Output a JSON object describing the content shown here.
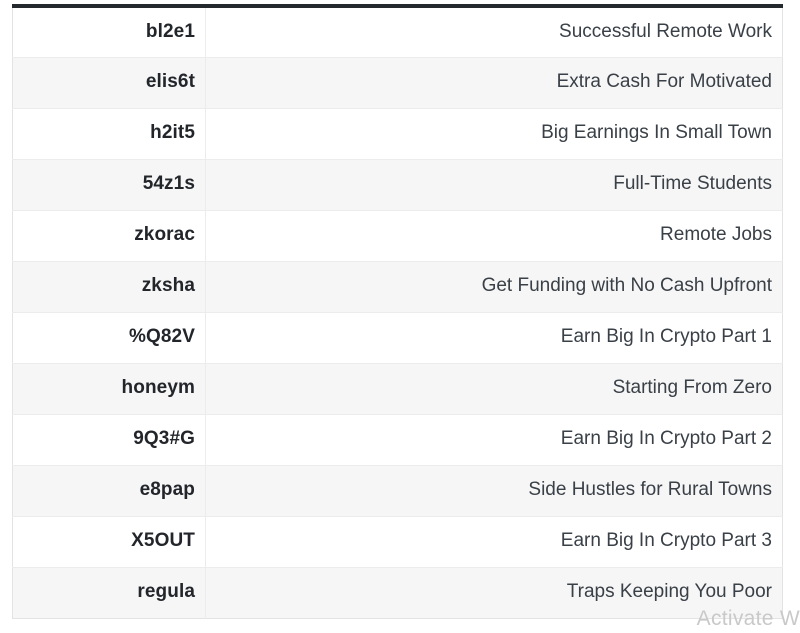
{
  "table": {
    "columns": [
      {
        "key": "code",
        "header": ""
      },
      {
        "key": "title",
        "header": ""
      }
    ],
    "rows": [
      {
        "code": "bl2e1",
        "title": "Successful Remote Work"
      },
      {
        "code": "elis6t",
        "title": "Extra Cash For Motivated"
      },
      {
        "code": "h2it5",
        "title": "Big Earnings In Small Town"
      },
      {
        "code": "54z1s",
        "title": "Full-Time Students"
      },
      {
        "code": "zkorac",
        "title": "Remote Jobs"
      },
      {
        "code": "zksha",
        "title": "Get Funding with No Cash Upfront"
      },
      {
        "code": "%Q82V",
        "title": "Earn Big In Crypto Part 1"
      },
      {
        "code": "honeym",
        "title": "Starting From Zero"
      },
      {
        "code": "9Q3#G",
        "title": "Earn Big In Crypto Part 2"
      },
      {
        "code": "e8pap",
        "title": "Side Hustles for Rural Towns"
      },
      {
        "code": "X5OUT",
        "title": "Earn Big In Crypto Part 3"
      },
      {
        "code": "regula",
        "title": "Traps Keeping You Poor"
      }
    ]
  },
  "watermark": {
    "text": "Activate W"
  },
  "colors": {
    "top_border": "#24292e",
    "row_stripe": "#f6f6f6",
    "row_base": "#ffffff",
    "grid_line": "#ececec",
    "code_text": "#22262b",
    "title_text": "#3a4047",
    "watermark_text": "#c9c9c9"
  }
}
